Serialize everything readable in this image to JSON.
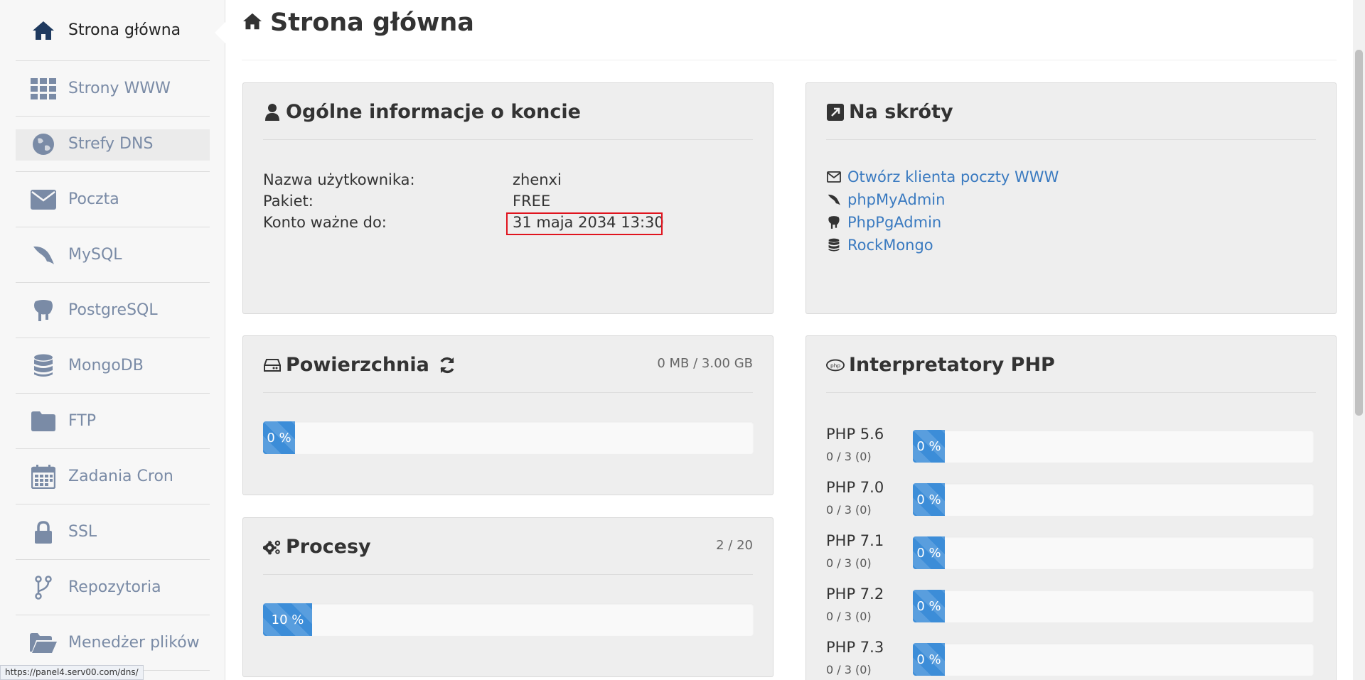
{
  "sidebar": {
    "items": [
      {
        "label": "Strona główna",
        "icon": "home-icon"
      },
      {
        "label": "Strony WWW",
        "icon": "grid-icon"
      },
      {
        "label": "Strefy DNS",
        "icon": "globe-icon"
      },
      {
        "label": "Poczta",
        "icon": "envelope-icon"
      },
      {
        "label": "MySQL",
        "icon": "dolphin-icon"
      },
      {
        "label": "PostgreSQL",
        "icon": "elephant-icon"
      },
      {
        "label": "MongoDB",
        "icon": "database-icon"
      },
      {
        "label": "FTP",
        "icon": "folder-icon"
      },
      {
        "label": "Zadania Cron",
        "icon": "calendar-icon"
      },
      {
        "label": "SSL",
        "icon": "lock-icon"
      },
      {
        "label": "Repozytoria",
        "icon": "branch-icon"
      },
      {
        "label": "Menedżer plików",
        "icon": "folder-open-icon"
      }
    ]
  },
  "page": {
    "title": "Strona główna"
  },
  "account": {
    "title": "Ogólne informacje o koncie",
    "rows": [
      {
        "key": "Nazwa użytkownika:",
        "value": "zhenxi"
      },
      {
        "key": "Pakiet:",
        "value": "FREE"
      },
      {
        "key": "Konto ważne do:",
        "value": "31 maja 2034 13:30"
      }
    ]
  },
  "shortcuts": {
    "title": "Na skróty",
    "links": [
      {
        "label": "Otwórz klienta poczty WWW",
        "icon": "envelope-icon"
      },
      {
        "label": "phpMyAdmin",
        "icon": "dolphin-icon"
      },
      {
        "label": "PhpPgAdmin",
        "icon": "elephant-icon"
      },
      {
        "label": "RockMongo",
        "icon": "database-icon"
      }
    ]
  },
  "storage": {
    "title": "Powierzchnia",
    "usage": "0 MB / 3.00 GB",
    "percent_label": "0 %",
    "percent": 0
  },
  "processes": {
    "title": "Procesy",
    "usage": "2 / 20",
    "percent_label": "10 %",
    "percent": 10
  },
  "php": {
    "title": "Interpretatory PHP",
    "rows": [
      {
        "version": "PHP 5.6",
        "count": "0 / 3 (0)",
        "percent_label": "0 %",
        "percent": 0
      },
      {
        "version": "PHP 7.0",
        "count": "0 / 3 (0)",
        "percent_label": "0 %",
        "percent": 0
      },
      {
        "version": "PHP 7.1",
        "count": "0 / 3 (0)",
        "percent_label": "0 %",
        "percent": 0
      },
      {
        "version": "PHP 7.2",
        "count": "0 / 3 (0)",
        "percent_label": "0 %",
        "percent": 0
      },
      {
        "version": "PHP 7.3",
        "count": "0 / 3 (0)",
        "percent_label": "0 %",
        "percent": 0
      }
    ]
  },
  "status_bar": {
    "url": "https://panel4.serv00.com/dns/"
  },
  "colors": {
    "accent": "#3c8dd8",
    "link": "#3a7ac0",
    "highlight_border": "#e0141e"
  }
}
